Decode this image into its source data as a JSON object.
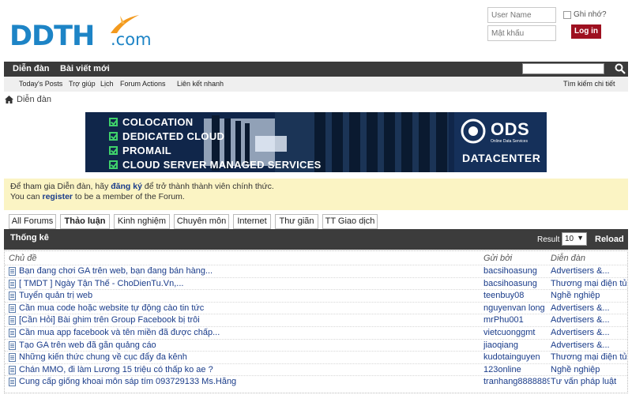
{
  "header": {
    "logo_main": "DDTH",
    "logo_domain": ".com",
    "login": {
      "username_placeholder": "User Name",
      "password_placeholder": "Mật khẩu",
      "remember_label": "Ghi nhớ?",
      "login_button": "Log in"
    }
  },
  "navbar": {
    "items": [
      {
        "label": "Diễn đàn"
      },
      {
        "label": "Bài viết mới"
      }
    ],
    "search_placeholder": ""
  },
  "subnav": {
    "items": [
      {
        "label": "Today's Posts"
      },
      {
        "label": "Trợ giúp"
      },
      {
        "label": "Lịch"
      },
      {
        "label": "Forum Actions"
      },
      {
        "label": "Liên kết nhanh"
      }
    ],
    "advanced_search": "Tìm kiếm chi tiết"
  },
  "breadcrumb": {
    "label": "Diễn đàn"
  },
  "banner": {
    "items": [
      "COLOCATION",
      "DEDICATED CLOUD",
      "PROMAIL",
      "CLOUD SERVER MANAGED SERVICES"
    ],
    "brand": "ODS",
    "brand_sub": "Online Data Services",
    "tagline": "DATACENTER"
  },
  "notice": {
    "line1_before": "Để tham gia Diễn đàn, hãy ",
    "line1_link": "đăng ký",
    "line1_after": " để trở thành thành viên chính thức.",
    "line2_before": "You can ",
    "line2_link": "register",
    "line2_after": " to be a member of the Forum."
  },
  "tabs": [
    {
      "label": "All Forums",
      "active": false
    },
    {
      "label": "Thảo luận",
      "active": true
    },
    {
      "label": "Kinh nghiệm",
      "active": false
    },
    {
      "label": "Chuyên môn",
      "active": false
    },
    {
      "label": "Internet",
      "active": false
    },
    {
      "label": "Thư giãn",
      "active": false
    },
    {
      "label": "TT Giao dịch",
      "active": false
    }
  ],
  "list": {
    "title": "Thống kê",
    "result_label": "Result",
    "result_value": "10",
    "reload_label": "Reload",
    "columns": {
      "topic": "Chủ đề",
      "author": "Gửi bởi",
      "forum": "Diễn đàn"
    },
    "rows": [
      {
        "title": "Bạn đang chơi GA trên web, bạn đang bán hàng...",
        "author": "bacsihoasung",
        "forum": "Advertisers &..."
      },
      {
        "title": "[ TMDT ] Ngày Tận Thế - ChoDienTu.Vn,...",
        "author": "bacsihoasung",
        "forum": "Thương mại điện tử"
      },
      {
        "title": "Tuyển quản trị web",
        "author": "teenbuy08",
        "forum": "Nghề nghiệp"
      },
      {
        "title": "Cần mua code hoặc website tự động cào tin tức",
        "author": "nguyenvan long",
        "forum": "Advertisers &..."
      },
      {
        "title": "[Cần Hỏi] Bài ghim trên Group Facebook bị trôi",
        "author": "mrPhu001",
        "forum": "Advertisers &..."
      },
      {
        "title": "Cần mua app facebook và tên miền đã được chấp...",
        "author": "vietcuonggmt",
        "forum": "Advertisers &..."
      },
      {
        "title": "Tạo GA trên web đã gắn quảng cáo",
        "author": "jiaoqiang",
        "forum": "Advertisers &..."
      },
      {
        "title": "Những kiến thức chung về cục đẩy đa kênh",
        "author": "kudotainguyen",
        "forum": "Thương mại điện tử"
      },
      {
        "title": "Chán MMO, đi làm Lương 15 triệu có thấp ko ae ?",
        "author": "123online",
        "forum": "Nghề nghiệp"
      },
      {
        "title": "Cung cấp giống khoai môn sáp tím 093729133 Ms.Hằng",
        "author": "tranhang8888889",
        "forum": "Tư vấn pháp luật"
      }
    ]
  },
  "colors": {
    "logo_blue": "#1d84c6",
    "logo_orange": "#f39a1e",
    "login_button": "#9e1020",
    "navbar": "#3a3a3a",
    "notice_bg": "#fbf4c4",
    "link": "#1a3c8a"
  }
}
